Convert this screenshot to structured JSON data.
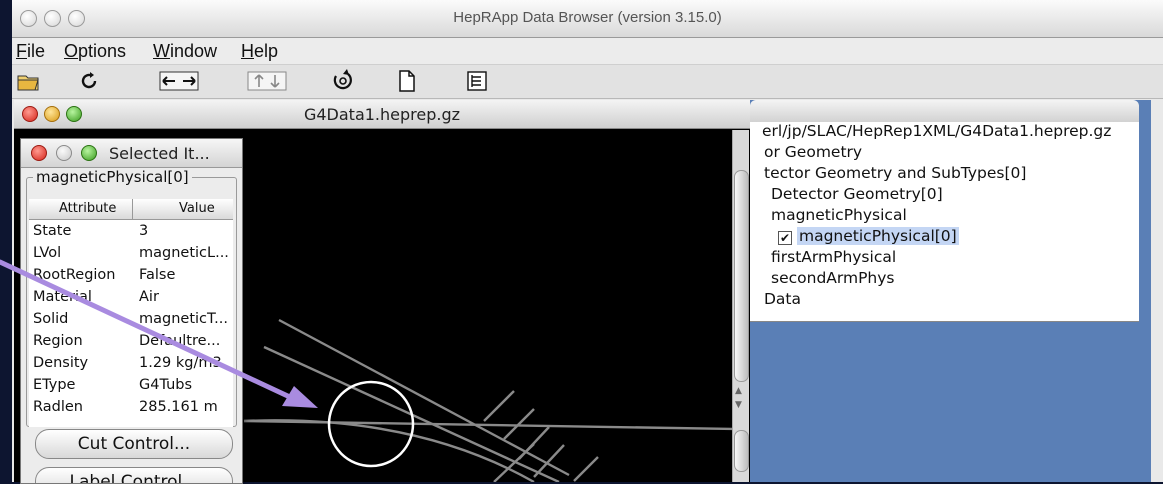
{
  "app": {
    "window_title": "HepRApp Data Browser (version 3.15.0)"
  },
  "menu": [
    {
      "label": "File"
    },
    {
      "label": "Options"
    },
    {
      "label": "Window"
    },
    {
      "label": "Help"
    }
  ],
  "toolbar_icons": [
    "open-folder-icon",
    "reload-icon",
    "swap-horizontal-icon",
    "swap-vertical-icon",
    "rotate-icon",
    "new-page-icon",
    "tree-view-icon"
  ],
  "viewer": {
    "title": "G4Data1.heprep.gz"
  },
  "selected_panel": {
    "title": "Selected It...",
    "group_label": "magneticPhysical[0]",
    "columns": [
      "Attribute",
      "Value"
    ],
    "rows": [
      {
        "k": "State",
        "v": "3"
      },
      {
        "k": "LVol",
        "v": "magneticL..."
      },
      {
        "k": "RootRegion",
        "v": "False"
      },
      {
        "k": "Material",
        "v": "Air"
      },
      {
        "k": "Solid",
        "v": "magneticT..."
      },
      {
        "k": "Region",
        "v": "Defaultre..."
      },
      {
        "k": "Density",
        "v": "1.29 kg/m3"
      },
      {
        "k": "EType",
        "v": "G4Tubs"
      },
      {
        "k": "Radlen",
        "v": "285.161 m"
      }
    ],
    "buttons": [
      "Cut Control...",
      "Label Control..."
    ]
  },
  "tree": {
    "items": [
      {
        "label": "erl/jp/SLAC/HepRep1XML/G4Data1.heprep.gz",
        "checked": false
      },
      {
        "label": "or Geometry",
        "checked": false
      },
      {
        "label": "tector Geometry and SubTypes[0]",
        "checked": false
      },
      {
        "label": "Detector Geometry[0]",
        "checked": false
      },
      {
        "label": "magneticPhysical",
        "checked": false
      },
      {
        "label": "magneticPhysical[0]",
        "checked": true
      },
      {
        "label": "firstArmPhysical",
        "checked": false
      },
      {
        "label": "secondArmPhys",
        "checked": false
      },
      {
        "label": "Data",
        "checked": false
      }
    ]
  },
  "colors": {
    "arrow": "#a98be0",
    "viewer_bg": "#000000",
    "tree_highlight": "#c4d6f4",
    "desktop_bg": "#5a7fb6"
  }
}
